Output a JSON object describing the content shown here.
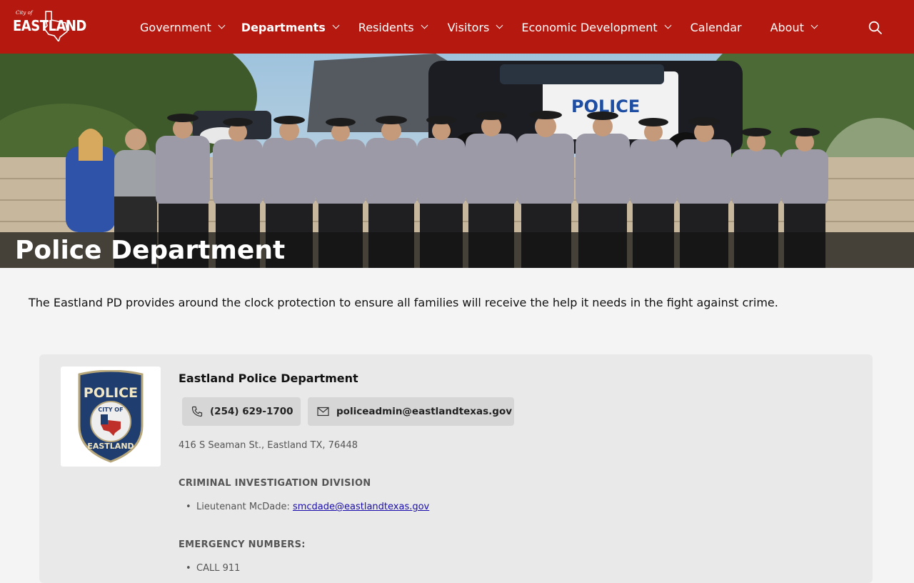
{
  "header": {
    "logo": {
      "small_text": "City of",
      "main_text": "EASTLAND"
    },
    "nav": [
      {
        "label": "Government",
        "has_dropdown": true,
        "active": false
      },
      {
        "label": "Departments",
        "has_dropdown": true,
        "active": true
      },
      {
        "label": "Residents",
        "has_dropdown": true,
        "active": false
      },
      {
        "label": "Visitors",
        "has_dropdown": true,
        "active": false
      },
      {
        "label": "Economic Development",
        "has_dropdown": true,
        "active": false
      },
      {
        "label": "Calendar",
        "has_dropdown": false,
        "active": false
      },
      {
        "label": "About",
        "has_dropdown": true,
        "active": false
      }
    ],
    "search_icon": "search-icon"
  },
  "hero": {
    "title": "Police Department"
  },
  "intro": {
    "text": "The Eastland PD provides around the clock protection to ensure all families will receive the help it needs in the fight against crime."
  },
  "card": {
    "badge": {
      "top_text": "POLICE",
      "middle_text": "CITY OF",
      "bottom_text": "EASTLAND"
    },
    "name": "Eastland Police Department",
    "phone": "(254) 629-1700",
    "email": "policeadmin@eastlandtexas.gov",
    "address": "416 S Seaman St., Eastland TX, 76448",
    "sections": [
      {
        "heading": "CRIMINAL INVESTIGATION DIVISION",
        "items": [
          {
            "label": "Lieutenant McDade: ",
            "link": "smcdade@eastlandtexas.gov"
          }
        ]
      },
      {
        "heading": "EMERGENCY NUMBERS:",
        "items": [
          {
            "label": "CALL 911"
          }
        ]
      }
    ]
  },
  "colors": {
    "header_bg": "#b5180f",
    "card_bg": "#e9e9e9",
    "pill_bg": "#d6d6d6",
    "page_bg": "#f4f4f4"
  }
}
